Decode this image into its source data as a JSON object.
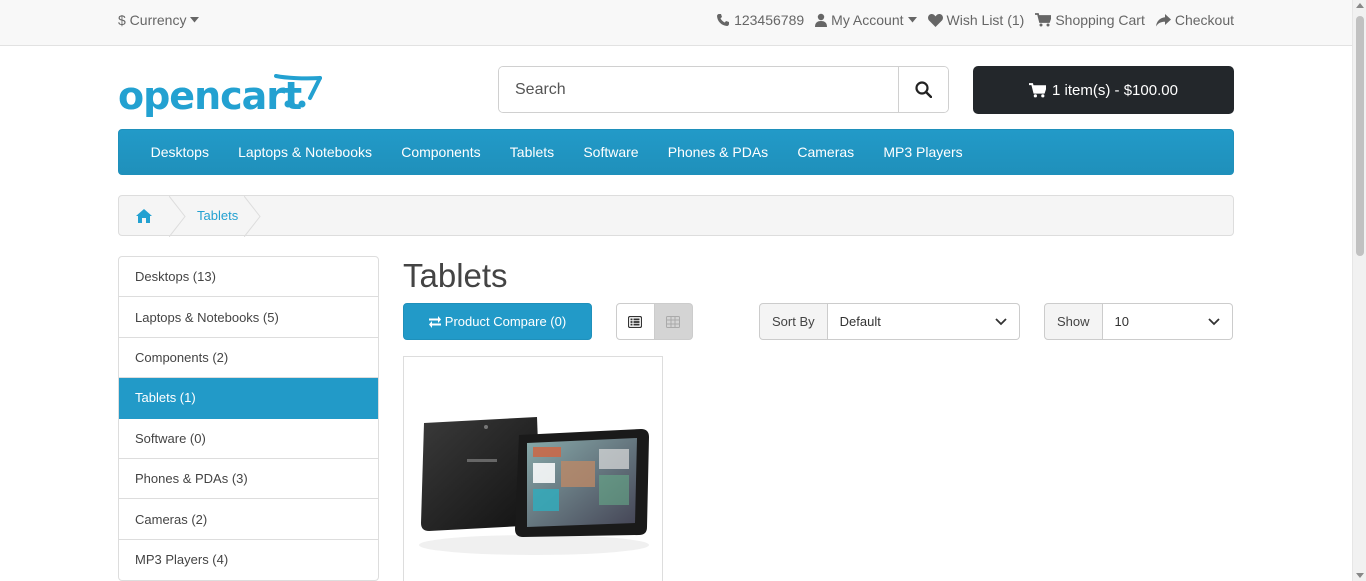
{
  "topbar": {
    "currency_label": "$ Currency",
    "phone": "123456789",
    "my_account": "My Account",
    "wish_list": "Wish List (1)",
    "shopping_cart": "Shopping Cart",
    "checkout": "Checkout"
  },
  "header": {
    "logo_text": "opencart",
    "search_placeholder": "Search",
    "search_value": "",
    "cart_label": "1 item(s) - $100.00"
  },
  "menu": {
    "items": [
      "Desktops",
      "Laptops & Notebooks",
      "Components",
      "Tablets",
      "Software",
      "Phones & PDAs",
      "Cameras",
      "MP3 Players"
    ]
  },
  "breadcrumb": {
    "current": "Tablets"
  },
  "sidebar": {
    "items": [
      {
        "label": "Desktops (13)",
        "active": false
      },
      {
        "label": "Laptops & Notebooks (5)",
        "active": false
      },
      {
        "label": "Components (2)",
        "active": false
      },
      {
        "label": "Tablets (1)",
        "active": true
      },
      {
        "label": "Software (0)",
        "active": false
      },
      {
        "label": "Phones & PDAs (3)",
        "active": false
      },
      {
        "label": "Cameras (2)",
        "active": false
      },
      {
        "label": "MP3 Players (4)",
        "active": false
      }
    ]
  },
  "content": {
    "title": "Tablets",
    "compare_label": "Product Compare (0)",
    "sort_label": "Sort By",
    "sort_value": "Default",
    "show_label": "Show",
    "show_value": "10"
  },
  "colors": {
    "accent": "#229ac8",
    "cart_bg": "#23272b"
  }
}
